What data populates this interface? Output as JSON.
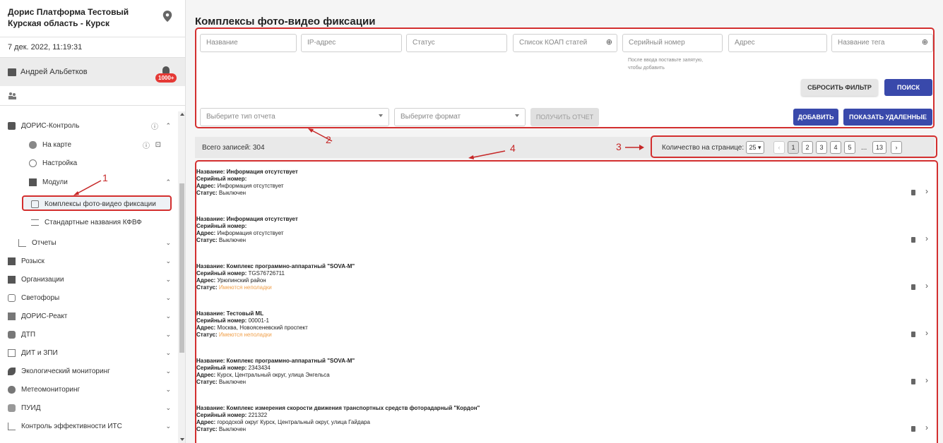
{
  "sidebar": {
    "org": "Дорис Платформа Тестовый",
    "region": "Курская область - Курск",
    "datetime": "7 дек. 2022, 11:19:31",
    "user": "Андрей Альбетков",
    "notif_badge": "1000+",
    "nav": [
      {
        "label": "ДОРИС-Контроль",
        "key": "doris-control"
      },
      {
        "label": "На карте",
        "key": "on-map"
      },
      {
        "label": "Настройка",
        "key": "settings"
      },
      {
        "label": "Модули",
        "key": "modules"
      },
      {
        "label": "Комплексы фото-видео фиксации",
        "key": "photo-video"
      },
      {
        "label": "Стандартные названия КФВФ",
        "key": "standard-names"
      },
      {
        "label": "Отчеты",
        "key": "reports"
      },
      {
        "label": "Розыск",
        "key": "search"
      },
      {
        "label": "Организации",
        "key": "organizations"
      },
      {
        "label": "Светофоры",
        "key": "traffic-lights"
      },
      {
        "label": "ДОРИС-Реакт",
        "key": "doris-react"
      },
      {
        "label": "ДТП",
        "key": "dtp"
      },
      {
        "label": "ДИТ и ЗПИ",
        "key": "dit-zpi"
      },
      {
        "label": "Экологический мониторинг",
        "key": "eco"
      },
      {
        "label": "Метеомониторинг",
        "key": "meteo"
      },
      {
        "label": "ПУИД",
        "key": "puid"
      },
      {
        "label": "Контроль эффективности ИТС",
        "key": "its"
      }
    ]
  },
  "main": {
    "title": "Комплексы фото-видео фиксации",
    "filters": {
      "name": "Название",
      "ip": "IP-адрес",
      "status": "Статус",
      "koap": "Список КОАП статей",
      "serial": "Серийный номер",
      "address": "Адрес",
      "tag": "Название тега",
      "hint_line1": "После ввода поставьте запятую,",
      "hint_line2": "чтобы добавить"
    },
    "buttons": {
      "reset": "СБРОСИТЬ ФИЛЬТР",
      "search": "ПОИСК",
      "report_type": "Выберите тип отчета",
      "format": "Выберите формат",
      "get_report": "ПОЛУЧИТЬ ОТЧЕТ",
      "add": "ДОБАВИТЬ",
      "show_deleted": "ПОКАЗАТЬ УДАЛЕННЫЕ"
    },
    "stats": {
      "total": "Всего записей: 304",
      "per_page_label": "Количество на странице:",
      "per_page": "25",
      "pages": [
        "1",
        "2",
        "3",
        "4",
        "5",
        "...",
        "13"
      ],
      "prev": "‹",
      "next": "›"
    },
    "field_labels": {
      "name": "Название:",
      "serial": "Серийный номер:",
      "address": "Адрес:",
      "status": "Статус:"
    },
    "rows": [
      {
        "name": "Информация отсутствует",
        "serial": "",
        "address": "Информация отсутствует",
        "status": "Выключен"
      },
      {
        "name": "Информация отсутствует",
        "serial": "",
        "address": "Информация отсутствует",
        "status": "Выключен"
      },
      {
        "name": "Комплекс программно-аппаратный \"SOVA-M\"",
        "serial": "TGS76726711",
        "address": "Урюпинский район",
        "status": "Имеются неполадки"
      },
      {
        "name": "Тестовый ML",
        "serial": "00001-1",
        "address": "Москва, Новоясеневский проспект",
        "status": "Имеются неполадки"
      },
      {
        "name": "Комплекс программно-аппаратный \"SOVA-M\"",
        "serial": "2343434",
        "address": "Курск, Центральный округ, улица Энгельса",
        "status": "Выключен"
      },
      {
        "name": "Комплекс измерения скорости движения транспортных средств фоторадарный \"Кордон\"",
        "serial": "221322",
        "address": "городской округ Курск, Центральный округ, улица Гайдара",
        "status": "Выключен"
      }
    ]
  },
  "annotations": [
    "1",
    "2",
    "3",
    "4"
  ],
  "colors": {
    "accent": "#3949ab",
    "highlight": "#d32f2f",
    "warning": "#f0a04b"
  }
}
